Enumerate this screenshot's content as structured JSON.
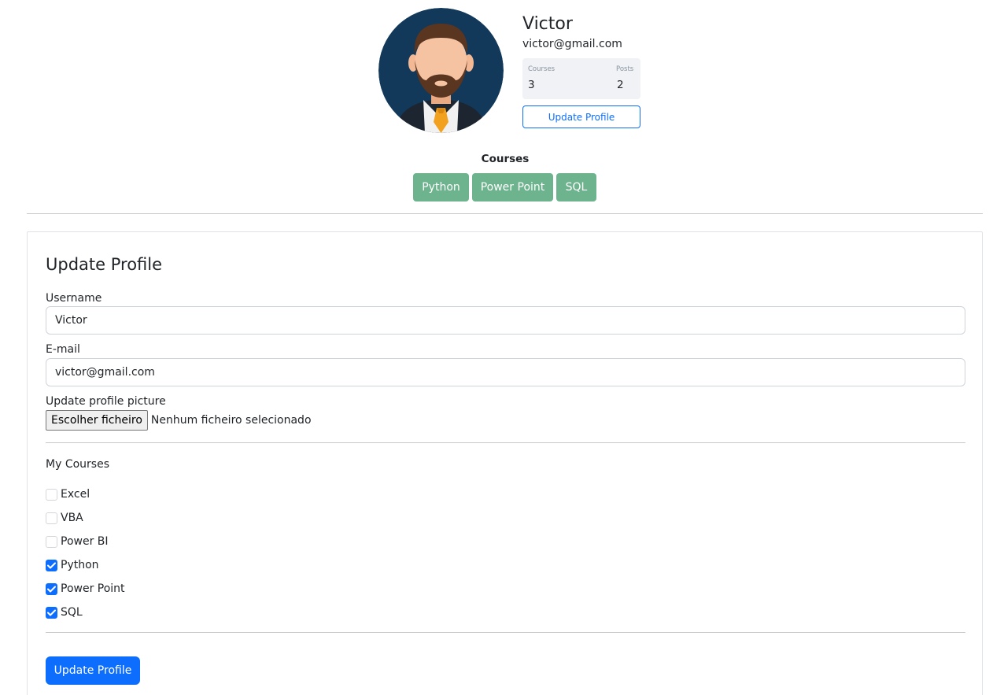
{
  "profile": {
    "name": "Victor",
    "email": "victor@gmail.com",
    "avatar_icon": "bearded-man-avatar-icon",
    "stats": {
      "courses_label": "Courses",
      "courses_value": "3",
      "posts_label": "Posts",
      "posts_value": "2"
    },
    "update_button_label": "Update Profile"
  },
  "courses_section": {
    "title": "Courses",
    "badges": [
      "Python",
      "Power Point",
      "SQL"
    ]
  },
  "form": {
    "title": "Update Profile",
    "username_label": "Username",
    "username_value": "Victor",
    "email_label": "E-mail",
    "email_value": "victor@gmail.com",
    "picture_label": "Update profile picture",
    "file_button_label": "Escolher ficheiro",
    "file_status": "Nenhum ficheiro selecionado",
    "my_courses_label": "My Courses",
    "courses": [
      {
        "label": "Excel",
        "checked": false
      },
      {
        "label": "VBA",
        "checked": false
      },
      {
        "label": "Power BI",
        "checked": false
      },
      {
        "label": "Python",
        "checked": true
      },
      {
        "label": "Power Point",
        "checked": true
      },
      {
        "label": "SQL",
        "checked": true
      }
    ],
    "submit_label": "Update Profile"
  },
  "colors": {
    "primary": "#0d6efd",
    "badge": "#6cb38e",
    "avatar_bg": "#12385a"
  }
}
